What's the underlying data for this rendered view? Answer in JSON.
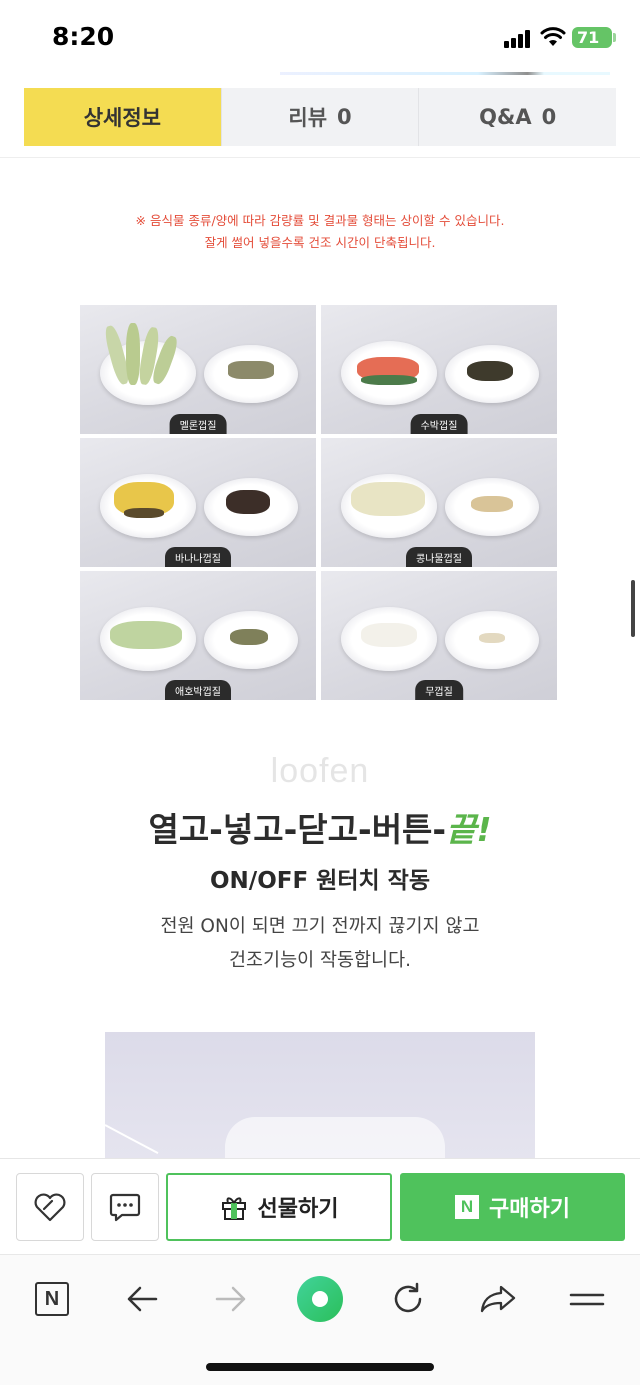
{
  "status": {
    "time": "8:20",
    "battery": "71"
  },
  "tabs": [
    {
      "label": "상세정보",
      "count": ""
    },
    {
      "label": "리뷰",
      "count": "0"
    },
    {
      "label": "Q&A",
      "count": "0"
    }
  ],
  "notice": {
    "line1": "※ 음식물 종류/양에 따라 감량률 및 결과물 형태는 상이할 수 있습니다.",
    "line2": "잘게 썰어 넣을수록 건조 시간이 단축됩니다."
  },
  "grid": [
    {
      "label": "멜론껍질"
    },
    {
      "label": "수박껍질"
    },
    {
      "label": "바나나껍질"
    },
    {
      "label": "콩나물껍질"
    },
    {
      "label": "애호박껍질"
    },
    {
      "label": "무껍질"
    }
  ],
  "brand": "loofen",
  "headline": {
    "main": "열고-넣고-닫고-버튼-",
    "accent": "끝!"
  },
  "subhead": "ON/OFF 원터치 작동",
  "desc": {
    "line1": "전원 ON이 되면 끄기 전까지 끊기지 않고",
    "line2": "건조기능이 작동합니다."
  },
  "actions": {
    "gift_label": "선물하기",
    "buy_label": "구매하기",
    "npay_mark": "N"
  },
  "browser": {
    "logo": "N"
  },
  "colors": {
    "tab_active": "#f4dc52",
    "accent_green": "#4fc25c",
    "notice_red": "#e44d3a"
  }
}
